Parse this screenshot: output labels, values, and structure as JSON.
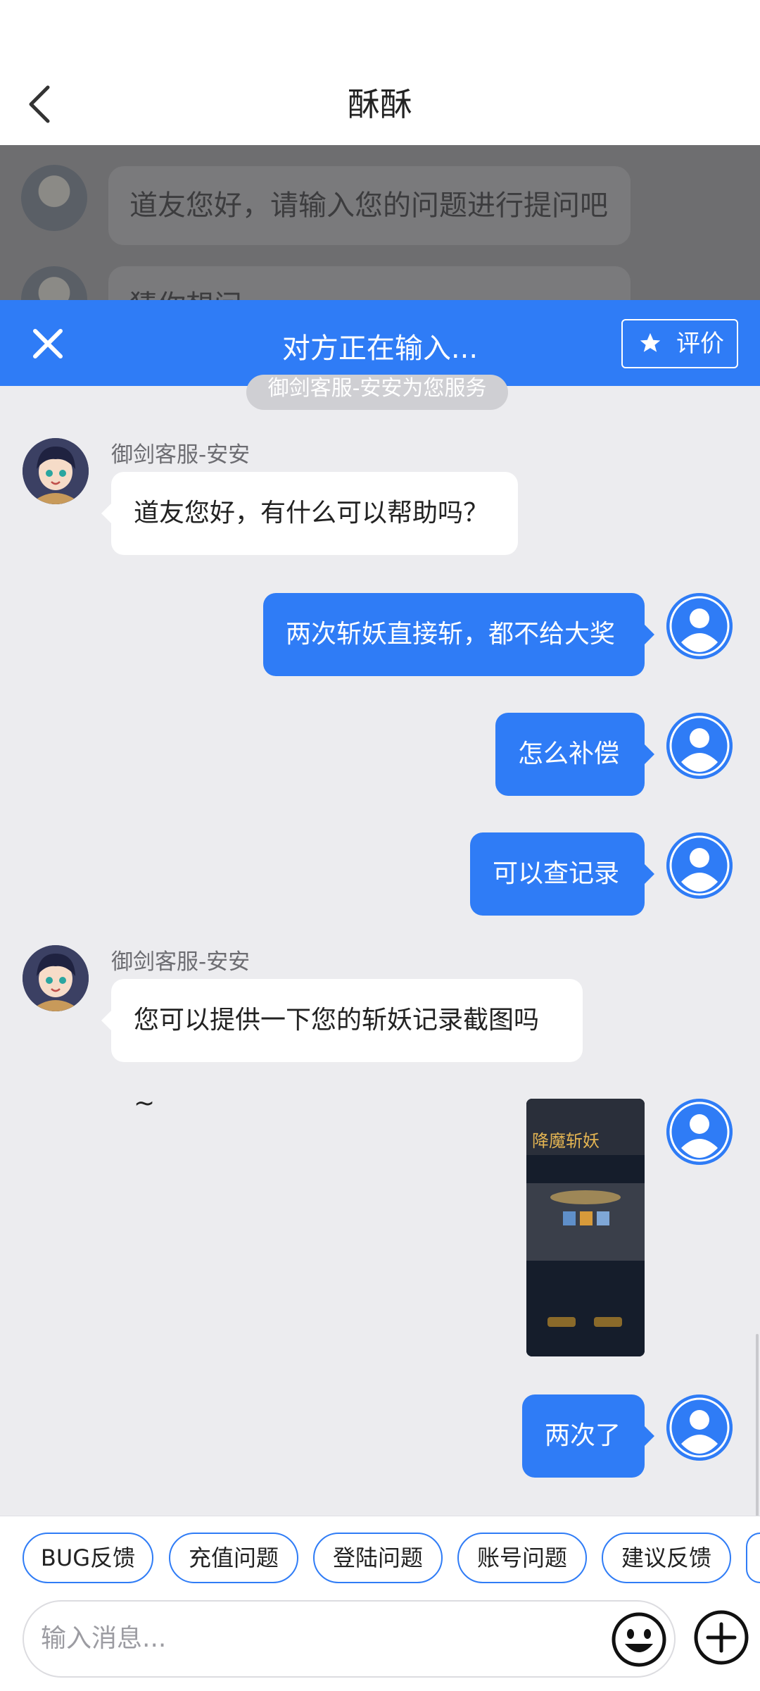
{
  "header": {
    "title": "酥酥"
  },
  "background_chat": {
    "greeting": "道友您好，请输入您的问题进行提问吧",
    "partial": "猜你想问"
  },
  "overlay": {
    "typing_status": "对方正在输入...",
    "rate_label": "评价",
    "service_notice": "御剑客服-安安为您服务"
  },
  "messages": [
    {
      "from": "agent",
      "name": "御剑客服-安安",
      "text": "道友您好，有什么可以帮助吗？"
    },
    {
      "from": "user",
      "text": "两次斩妖直接斩，都不给大奖"
    },
    {
      "from": "user",
      "text": "怎么补偿"
    },
    {
      "from": "user",
      "text": "可以查记录"
    },
    {
      "from": "agent",
      "name": "御剑客服-安安",
      "text": "您可以提供一下您的斩妖记录截图吗~"
    },
    {
      "from": "user",
      "type": "image",
      "caption": "降魔斩妖"
    },
    {
      "from": "user",
      "text": "两次了"
    }
  ],
  "quick_replies": [
    "BUG反馈",
    "充值问题",
    "登陆问题",
    "账号问题",
    "建议反馈"
  ],
  "input": {
    "placeholder": "输入消息..."
  },
  "icons": {
    "back": "chevron-left-icon",
    "close": "close-icon",
    "rate": "star-icon",
    "emoji": "smiley-icon",
    "add": "plus-circle-icon",
    "user_avatar": "person-icon"
  },
  "colors": {
    "accent": "#2f7cf6",
    "bubble_agent": "#ffffff",
    "background": "#ececef"
  }
}
